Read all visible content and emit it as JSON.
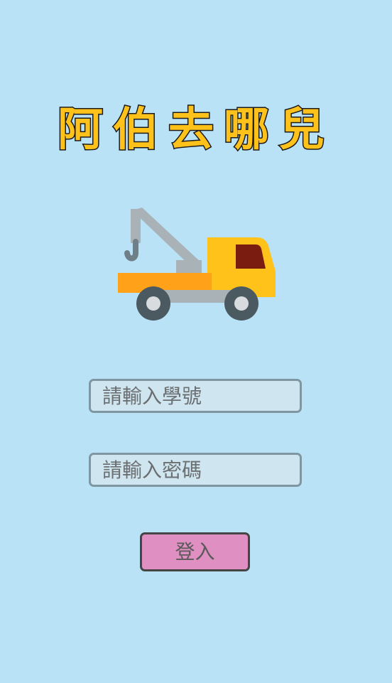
{
  "app": {
    "title": "阿伯去哪兒",
    "logo_icon": "tow-truck-icon"
  },
  "login_form": {
    "student_id_placeholder": "請輸入學號",
    "password_placeholder": "請輸入密碼",
    "submit_label": "登入"
  },
  "colors": {
    "background": "#b9e2f7",
    "title_fill": "#ffc21a",
    "input_fill": "#cfe5ef",
    "button_fill": "#e08fc2"
  }
}
